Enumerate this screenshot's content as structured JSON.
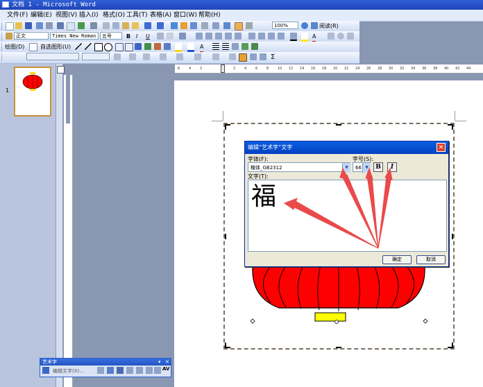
{
  "window": {
    "title": "文档 1 - Microsoft Word"
  },
  "menu": [
    "文件(F)",
    "编辑(E)",
    "视图(V)",
    "插入(I)",
    "格式(O)",
    "工具(T)",
    "表格(A)",
    "窗口(W)",
    "帮助(H)"
  ],
  "standard_toolbar": {
    "zoom": "100%",
    "read_label": "阅读(R)"
  },
  "formatting_toolbar": {
    "style": "正文",
    "font": "Times New Roman",
    "size": "五号"
  },
  "drawing_toolbar": {
    "draw_label": "绘图(D)",
    "autoshapes_label": "自选图形(U)"
  },
  "thumbnails": {
    "page_number": "1"
  },
  "ruler": {
    "ticks": [
      "6",
      "4",
      "2",
      "2",
      "4",
      "6",
      "8",
      "10",
      "12",
      "14",
      "16",
      "18",
      "20",
      "22",
      "24",
      "26",
      "28",
      "30",
      "32",
      "34",
      "36",
      "38",
      "40",
      "42",
      "44"
    ]
  },
  "dialog": {
    "title": "编辑“艺术字”文字",
    "font_label": "字体(F):",
    "font_value": "楷体_GB2312",
    "size_label": "字号(S):",
    "size_value": "66",
    "bold_label": "B",
    "italic_label": "I",
    "text_label": "文字(T):",
    "text_value": "福",
    "ok_label": "确定",
    "cancel_label": "取消"
  },
  "wordart_toolbar": {
    "title": "艺术字",
    "edit_text_label": "编辑文字(X)...",
    "spacing_label": "AV"
  },
  "colors": {
    "accent": "#2f5fd6",
    "lantern_red": "#ff0000",
    "lantern_tassel": "#ffff00",
    "arrow": "#ea4a4a"
  }
}
